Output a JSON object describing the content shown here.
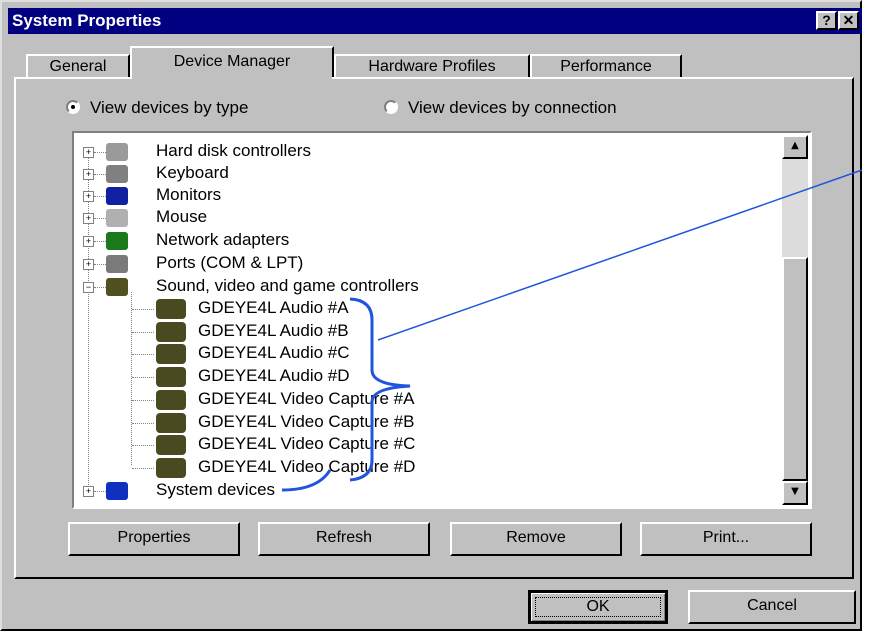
{
  "window": {
    "title": "System Properties",
    "help_button": "?",
    "close_button": "✕"
  },
  "tabs": [
    {
      "label": "General",
      "active": false
    },
    {
      "label": "Device Manager",
      "active": true
    },
    {
      "label": "Hardware Profiles",
      "active": false
    },
    {
      "label": "Performance",
      "active": false
    }
  ],
  "view_options": [
    {
      "label": "View devices by type",
      "selected": true
    },
    {
      "label": "View devices by connection",
      "selected": false
    }
  ],
  "devices": [
    {
      "label": "Hard disk controllers",
      "icon": "hard-disk-icon",
      "expander": "+"
    },
    {
      "label": "Keyboard",
      "icon": "keyboard-icon",
      "expander": "+"
    },
    {
      "label": "Monitors",
      "icon": "monitor-icon",
      "expander": "+"
    },
    {
      "label": "Mouse",
      "icon": "mouse-icon",
      "expander": "+"
    },
    {
      "label": "Network adapters",
      "icon": "network-adapter-icon",
      "expander": "+"
    },
    {
      "label": "Ports (COM & LPT)",
      "icon": "port-icon",
      "expander": "+"
    },
    {
      "label": "Sound, video and game controllers",
      "icon": "sound-controller-icon",
      "expander": "−"
    },
    {
      "label": "System devices",
      "icon": "computer-icon",
      "expander": "+"
    }
  ],
  "sound_children": [
    "GDEYE4L Audio #A",
    "GDEYE4L Audio #B",
    "GDEYE4L Audio #C",
    "GDEYE4L Audio #D",
    "GDEYE4L Video Capture #A",
    "GDEYE4L Video Capture #B",
    "GDEYE4L Video Capture #C",
    "GDEYE4L Video Capture #D"
  ],
  "action_buttons": {
    "properties": "Properties",
    "refresh": "Refresh",
    "remove": "Remove",
    "print": "Print..."
  },
  "dialog_buttons": {
    "ok": "OK",
    "cancel": "Cancel"
  },
  "annotation_color": "#2255dd"
}
